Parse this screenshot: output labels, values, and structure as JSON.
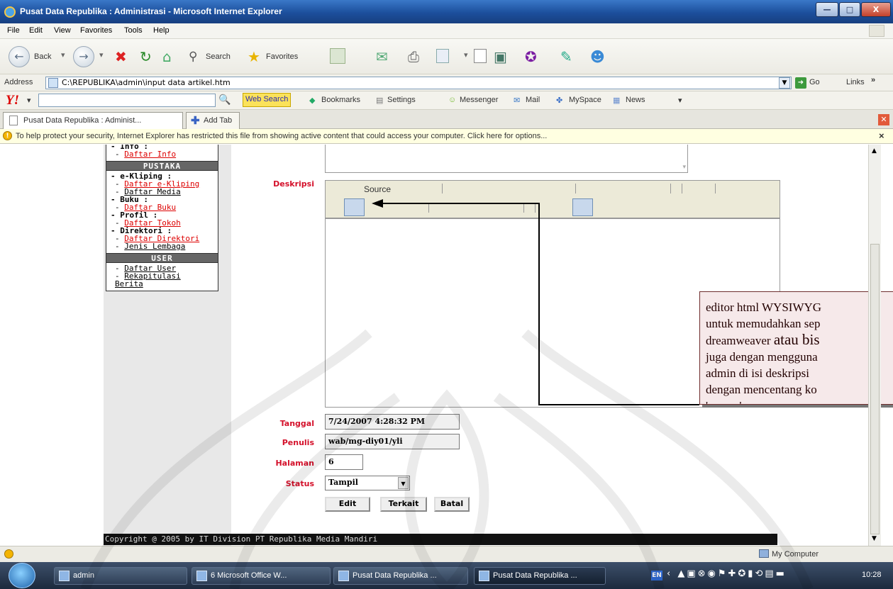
{
  "window": {
    "title": "Pusat Data Republika : Administrasi - Microsoft Internet Explorer",
    "minimize": "—",
    "maximize": "□",
    "close": "X"
  },
  "menu": [
    "File",
    "Edit",
    "View",
    "Favorites",
    "Tools",
    "Help"
  ],
  "toolbar": {
    "back": "Back",
    "search": "Search",
    "favorites": "Favorites"
  },
  "address": {
    "label": "Address",
    "url": "C:\\REPUBLIKA\\admin\\input data artikel.htm",
    "go": "Go",
    "links": "Links"
  },
  "yahoo": {
    "web_search": "Web Search",
    "bookmarks": "Bookmarks",
    "settings": "Settings",
    "messenger": "Messenger",
    "mail": "Mail",
    "myspace": "MySpace",
    "news": "News"
  },
  "tabs": {
    "active": "Pusat Data Republika : Administ...",
    "add": "Add Tab"
  },
  "infobar": {
    "text": "To help protect your security, Internet Explorer has restricted this file from showing active content that could access your computer. Click here for options..."
  },
  "sidebar": {
    "info_cat": "- Info :",
    "daftar_info": "Daftar Info",
    "pustaka_head": "PUSTAKA",
    "ekliping_cat": "- e-Kliping :",
    "daftar_ekliping": "Daftar e-Kliping",
    "daftar_media": "Daftar Media",
    "buku_cat": "- Buku :",
    "daftar_buku": "Daftar Buku",
    "profil_cat": "- Profil :",
    "daftar_tokoh": "Daftar Tokoh",
    "direktori_cat": "- Direktori :",
    "daftar_direktori": "Daftar Direktori",
    "jenis_lembaga": "Jenis Lembaga",
    "user_head": "USER",
    "daftar_user": "Daftar User",
    "rekap_berita": "Rekapitulasi Berita",
    "dash": "- "
  },
  "form": {
    "deskripsi_label": "Deskripsi",
    "source_label": "Source",
    "tanggal_label": "Tanggal",
    "tanggal_value": "7/24/2007 4:28:32 PM",
    "penulis_label": "Penulis",
    "penulis_value": "wab/mg-diy01/yli",
    "halaman_label": "Halaman",
    "halaman_value": "6",
    "status_label": "Status",
    "status_value": "Tampil",
    "edit": "Edit",
    "terkait": "Terkait",
    "batal": "Batal"
  },
  "copyright": "Copyright @ 2005 by IT Division PT Republika Media Mandiri",
  "callout": {
    "line1": "editor html WYSIWYG",
    "line2": "untuk memudahkan sep",
    "line3a": "dreamweaver ",
    "line3b": "atau bis",
    "line4": "juga dengan mengguna",
    "line5": "admin di isi deskripsi",
    "line6": "dengan mencentang ko",
    "line7": "'source'."
  },
  "status": {
    "zone": "My Computer"
  },
  "taskbar": {
    "tasks": [
      "admin",
      "6 Microsoft Office W...",
      "Pusat Data Republika ...",
      "Pusat Data Republika ..."
    ],
    "lang": "EN",
    "clock": "10:28"
  },
  "colors": {
    "title_blue": "#1c4f9c",
    "label_red": "#d4102a",
    "link_red": "#dd0000",
    "infobar_yellow": "#ffffe1"
  }
}
